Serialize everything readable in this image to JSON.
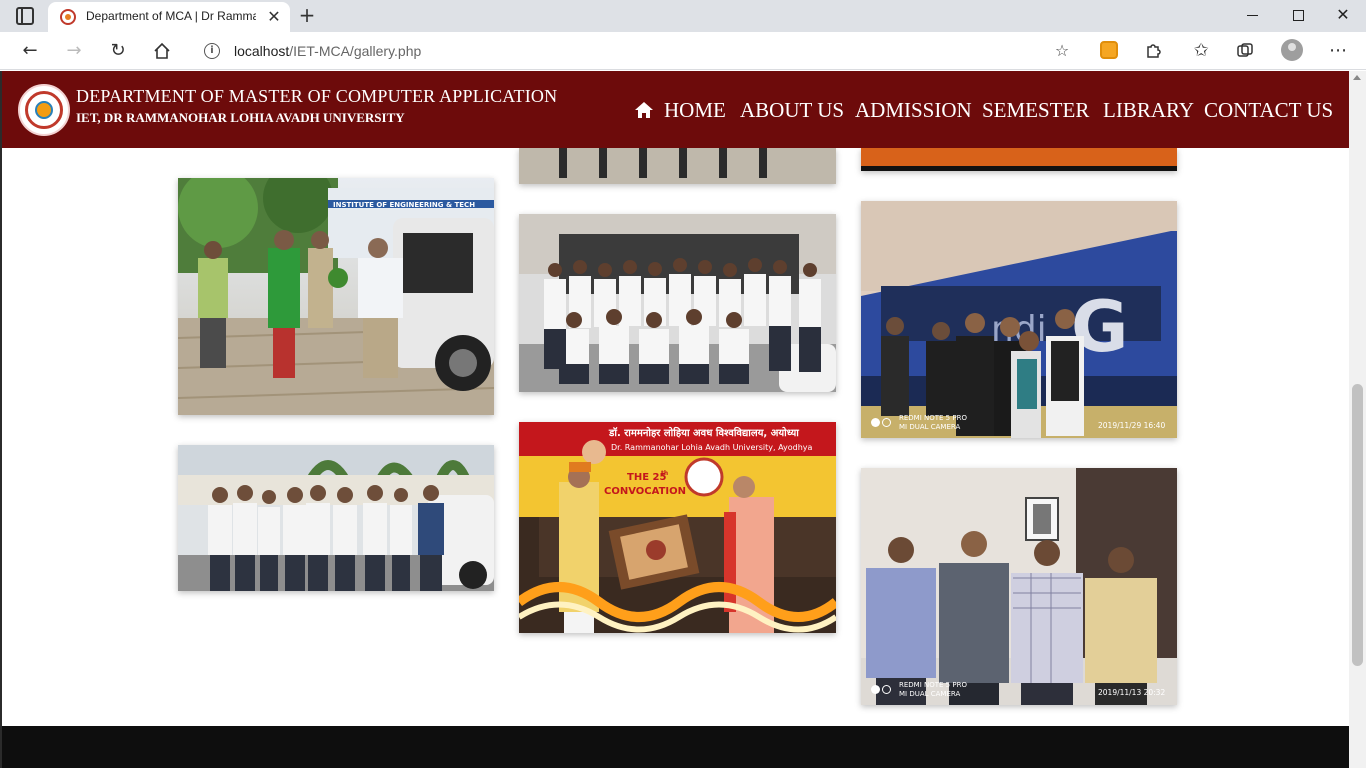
{
  "browser": {
    "tab_title": "Department of MCA | Dr Rammanohar Lohia Avadh University",
    "url_host": "localhost",
    "url_path": "/IET-MCA/gallery.php",
    "new_tab_symbol": "+",
    "close_symbol": "✕",
    "icons": [
      "tab-actions-icon",
      "back-icon",
      "forward-icon",
      "refresh-icon",
      "home-icon",
      "info-icon",
      "add-favorite-icon",
      "extension-icon",
      "puzzle-icon",
      "favorites-icon",
      "collections-icon",
      "profile-icon",
      "more-icon"
    ]
  },
  "header": {
    "title": "DEPARTMENT OF MASTER OF COMPUTER APPLICATION",
    "subtitle": "IET, DR RAMMANOHAR LOHIA AVADH UNIVERSITY",
    "nav": [
      "HOME",
      "ABOUT US",
      "ADMISSION",
      "SEMESTER",
      "LIBRARY",
      "CONTACT US"
    ]
  },
  "gallery": {
    "photo_stamps": [
      {
        "camera": "REDMI NOTE 5 PRO",
        "lens": "MI DUAL CAMERA",
        "datetime": "2019/11/29  16:40"
      },
      {
        "camera": "REDMI NOTE 5 PRO",
        "lens": "MI DUAL CAMERA",
        "datetime": "2019/11/13  20:32"
      }
    ],
    "banner_text": {
      "hindi": "डॉ. राममनोहर लोहिया अवध विश्वविद्यालय, अयोध्या",
      "english": "Dr. Rammanohar Lohia Avadh University, Ayodhya",
      "event_number": "THE 25",
      "event_suffix": "th",
      "event_name": "CONVOCATION"
    },
    "building_sign": "INSTITUTE OF ENGINEERING & TECH"
  },
  "colors": {
    "header_bg": "#6d0b0b",
    "footer_bg": "#0e0e0e"
  }
}
